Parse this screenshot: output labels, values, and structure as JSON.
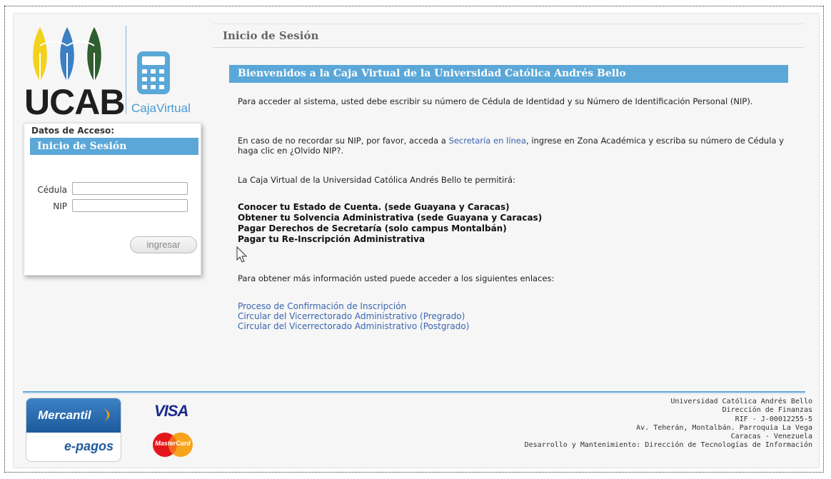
{
  "brand": {
    "logo_text": "UCAB",
    "app_name": "CajaVirtual",
    "colors": {
      "accent_blue": "#5aa7d8",
      "logo_yellow": "#f2d21b",
      "logo_blue": "#3d7fc3",
      "logo_green": "#2f5e2f"
    }
  },
  "login": {
    "legend": "Datos de Acceso:",
    "header": "Inicio de Sesión",
    "cedula_label": "Cédula",
    "cedula_value": "",
    "nip_label": "NIP",
    "nip_value": "",
    "submit_label": "ingresar"
  },
  "main": {
    "page_title": "Inicio de Sesión",
    "welcome": "Bienvenidos a la Caja Virtual de la Universidad Católica Andrés Bello",
    "intro": "Para acceder al sistema, usted debe escribir su número de Cédula de Identidad y su Número de Identificación Personal (NIP).",
    "forgot_before": "En caso de no recordar su NIP, por favor, acceda a ",
    "forgot_link": "Secretaría en línea",
    "forgot_after": ", ingrese en Zona Académica y escriba su número de Cédula y haga clic en ¿Olvido NIP?.",
    "features_intro": "La Caja Virtual de la Universidad Católica Andrés Bello te permitirá:",
    "features": [
      "Conocer tu Estado de Cuenta. (sede Guayana y Caracas)",
      "Obtener tu Solvencia Administrativa (sede Guayana y Caracas)",
      "Pagar Derechos de Secretaría (solo campus Montalbán)",
      "Pagar tu Re-Inscripción Administrativa"
    ],
    "links_intro": "Para obtener más información usted puede acceder a los siguientes enlaces:",
    "links": [
      "Proceso de Confirmación de Inscripción",
      "Circular del Vicerrectorado Administrativo (Pregrado)",
      "Circular del Vicerrectorado Administrativo (Postgrado)"
    ]
  },
  "footer": {
    "mercantil_name": "Mercantil",
    "mercantil_sub": "e-pagos",
    "visa": "VISA",
    "mastercard": "MasterCard",
    "info": [
      "Universidad Católica Andrés Bello",
      "Dirección de Finanzas",
      "RIF - J-00012255-5",
      "Av. Teherán, Montalbán. Parroquia La Vega",
      "Caracas - Venezuela",
      "Desarrollo y Mantenimiento: Dirección de Tecnologías de Información"
    ]
  }
}
